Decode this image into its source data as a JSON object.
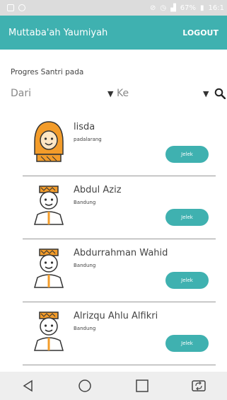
{
  "status_bar": {
    "battery": "67%",
    "time": "16:1"
  },
  "app_bar": {
    "title": "Muttaba'ah Yaumiyah",
    "logout_label": "LOGOUT"
  },
  "progress_label": "Progres Santri pada",
  "filter": {
    "from_label": "Dari",
    "to_label": "Ke"
  },
  "students": [
    {
      "name": "lisda",
      "city": "padalarang",
      "action_label": "Jelek",
      "avatar": "female-avatar"
    },
    {
      "name": "Abdul Aziz",
      "city": "Bandung",
      "action_label": "Jelek",
      "avatar": "male-avatar"
    },
    {
      "name": "Abdurrahman Wahid",
      "city": "Bandung",
      "action_label": "Jelek",
      "avatar": "male-avatar"
    },
    {
      "name": "Alrizqu Ahlu Alfikri",
      "city": "Bandung",
      "action_label": "Jelek",
      "avatar": "male-avatar"
    }
  ],
  "colors": {
    "accent": "#3fb1b0",
    "avatar_hat": "#f39c2a"
  }
}
